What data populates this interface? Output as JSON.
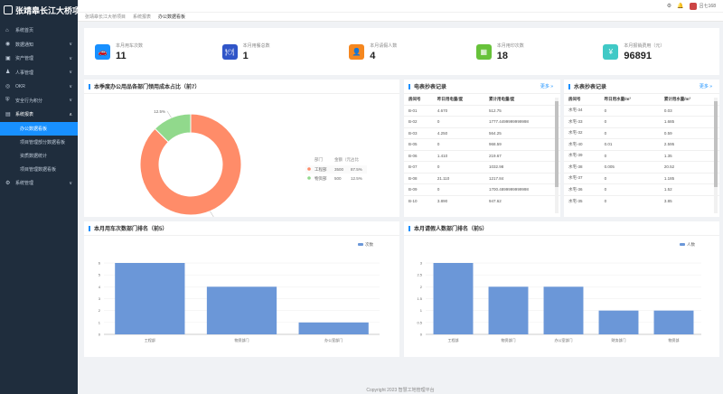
{
  "app": {
    "title": "张靖皋长江大桥项目"
  },
  "sidebar": {
    "items": [
      {
        "label": "系统首页",
        "icon": "home-icon"
      },
      {
        "label": "数据通知",
        "icon": "bell-icon",
        "arrow": "∨"
      },
      {
        "label": "资产管理",
        "icon": "box-icon",
        "arrow": "∨"
      },
      {
        "label": "人事管理",
        "icon": "user-icon",
        "arrow": "∨"
      },
      {
        "label": "OKR",
        "icon": "target-icon",
        "arrow": "∨"
      },
      {
        "label": "安全行为积分",
        "icon": "shield-icon",
        "arrow": "∨"
      },
      {
        "label": "系统报表",
        "icon": "report-icon",
        "arrow": "∧"
      }
    ],
    "sub_items": [
      "办公数据看板",
      "项目管理部分数据看板",
      "资质数据统计",
      "项目管理数据看板"
    ],
    "bottom_item": {
      "label": "系统管理",
      "icon": "gear-icon",
      "arrow": "∨"
    }
  },
  "topbar": {
    "username": "吕七168"
  },
  "breadcrumb": [
    "张靖皋长江大桥项目",
    "系统报表",
    "办公数据看板"
  ],
  "stats": [
    {
      "label": "本月用车次数",
      "value": "11",
      "color": "#1890ff",
      "icon": "car-icon"
    },
    {
      "label": "本月用餐总数",
      "value": "1",
      "color": "#3055c8",
      "icon": "meal-icon"
    },
    {
      "label": "本月请假人数",
      "value": "4",
      "color": "#f5871f",
      "icon": "person-icon"
    },
    {
      "label": "本月用印次数",
      "value": "18",
      "color": "#67c23a",
      "icon": "stamp-icon"
    },
    {
      "label": "本月报销费用（元）",
      "value": "96891",
      "color": "#40c9c6",
      "icon": "money-icon"
    }
  ],
  "pie_card": {
    "title": "本季度办公用品各部门领用成本占比（前7）",
    "headers": [
      "部门",
      "金额（元）",
      "占比"
    ],
    "rows": [
      {
        "name": "工程部",
        "amount": "3500",
        "pct": "87.5%",
        "color": "#ff8c69"
      },
      {
        "name": "物资部",
        "amount": "500",
        "pct": "12.5%",
        "color": "#91d98c"
      }
    ]
  },
  "elec_card": {
    "title": "电表抄表记录",
    "more": "更多 »",
    "headers": [
      "房间号",
      "昨日用电量/度",
      "累计用电量/度"
    ],
    "rows": [
      [
        "B-01",
        "4.670",
        "512.75"
      ],
      [
        "B-02",
        "0",
        "1777.4499999999998"
      ],
      [
        "B-03",
        "4.250",
        "564.25"
      ],
      [
        "B-05",
        "0",
        "968.59"
      ],
      [
        "B-06",
        "1.410",
        "219.67"
      ],
      [
        "B-07",
        "0",
        "1032.98"
      ],
      [
        "B-08",
        "21.110",
        "1217.84"
      ],
      [
        "B-09",
        "0",
        "1700.4899999999998"
      ],
      [
        "B-10",
        "3.890",
        "947.62"
      ]
    ]
  },
  "water_card": {
    "title": "水表抄表记录",
    "more": "更多 »",
    "headers": [
      "房间号",
      "昨日用水量/m³",
      "累计用水量/m³"
    ],
    "rows": [
      [
        "水宅-34",
        "0",
        "0.03"
      ],
      [
        "水宅-33",
        "0",
        "1.685"
      ],
      [
        "水宅-32",
        "0",
        "0.59"
      ],
      [
        "水宅-40",
        "0.01",
        "2.595"
      ],
      [
        "水宅-39",
        "0",
        "1.35"
      ],
      [
        "水宅-38",
        "0.005",
        "20.52"
      ],
      [
        "水宅-37",
        "0",
        "1.185"
      ],
      [
        "水宅-36",
        "0",
        "1.52"
      ],
      [
        "水宅-35",
        "0",
        "3.85"
      ]
    ]
  },
  "chart_data": [
    {
      "type": "pie",
      "title": "本季度办公用品各部门领用成本占比（前7）",
      "categories": [
        "工程部",
        "物资部"
      ],
      "values": [
        3500,
        500
      ],
      "data_labels": [
        "87.5%",
        "12.5%"
      ],
      "colors": [
        "#ff8c69",
        "#91d98c"
      ]
    },
    {
      "type": "bar",
      "title": "本月用车次数部门排名（前5）",
      "categories": [
        "工程部",
        "物资部门",
        "办公室部门"
      ],
      "values": [
        6,
        4,
        1
      ],
      "ylim": [
        0,
        6
      ],
      "yticks": [
        "0",
        "1",
        "2",
        "3",
        "4",
        "5",
        "6"
      ],
      "series": [
        {
          "name": "次数",
          "values": [
            6,
            4,
            1
          ]
        }
      ],
      "legend": "top-right",
      "color": "#6b97d8"
    },
    {
      "type": "bar",
      "title": "本月请假人数部门排名（前5）",
      "categories": [
        "工程部",
        "物资部门",
        "办公室部门",
        "财务部门",
        "物资部"
      ],
      "values": [
        3,
        2,
        2,
        1,
        1
      ],
      "ylim": [
        0,
        3
      ],
      "yticks": [
        "0",
        "0.5",
        "1",
        "1.5",
        "2",
        "2.5",
        "3"
      ],
      "series": [
        {
          "name": "人数",
          "values": [
            3,
            2,
            2,
            1,
            1
          ]
        }
      ],
      "legend": "top-right",
      "color": "#6b97d8"
    }
  ],
  "footer": "Copyright 2023 智慧工地管理平台"
}
